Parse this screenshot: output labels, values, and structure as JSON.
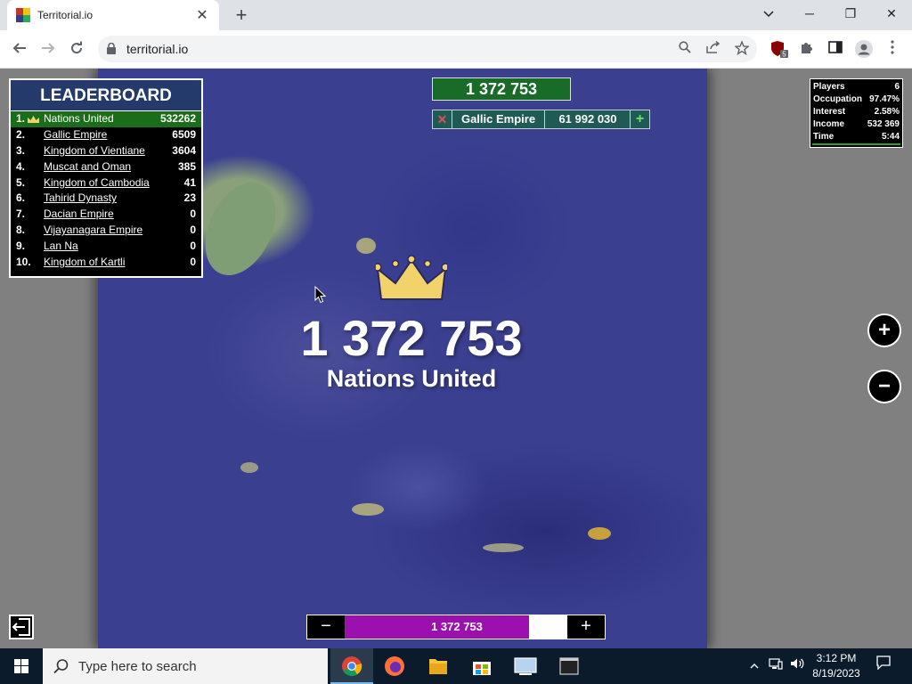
{
  "browser": {
    "tab_title": "Territorial.io",
    "tab_close": "✕",
    "new_tab": "+",
    "url": "territorial.io",
    "extension_badge": "5",
    "window_controls": {
      "minimize": "─",
      "maximize": "❐",
      "close": "✕"
    }
  },
  "leaderboard": {
    "title": "LEADERBOARD",
    "rows": [
      {
        "rank": "1.",
        "name": "Nations United",
        "score": "532262"
      },
      {
        "rank": "2.",
        "name": "Gallic Empire",
        "score": "6509"
      },
      {
        "rank": "3.",
        "name": "Kingdom of Vientiane",
        "score": "3604"
      },
      {
        "rank": "4.",
        "name": "Muscat and Oman",
        "score": "385"
      },
      {
        "rank": "5.",
        "name": "Kingdom of Cambodia",
        "score": "41"
      },
      {
        "rank": "6.",
        "name": "Tahirid Dynasty",
        "score": "23"
      },
      {
        "rank": "7.",
        "name": "Dacian Empire",
        "score": "0"
      },
      {
        "rank": "8.",
        "name": "Vijayanagara Empire",
        "score": "0"
      },
      {
        "rank": "9.",
        "name": "Lan Na",
        "score": "0"
      },
      {
        "rank": "10.",
        "name": "Kingdom of Kartli",
        "score": "0"
      }
    ]
  },
  "top_score": "1 372 753",
  "attack": {
    "close": "✕",
    "target": "Gallic Empire",
    "value": "61 992 030",
    "add": "+"
  },
  "stats": {
    "rows": [
      {
        "label": "Players",
        "value": "6"
      },
      {
        "label": "Occupation",
        "value": "97.47%"
      },
      {
        "label": "Interest",
        "value": "2.58%"
      },
      {
        "label": "Income",
        "value": "532 369"
      },
      {
        "label": "Time",
        "value": "5:44"
      }
    ]
  },
  "center": {
    "score": "1 372 753",
    "name": "Nations United"
  },
  "zoom": {
    "in": "+",
    "out": "−"
  },
  "bottom_bar": {
    "minus": "−",
    "value": "1 372 753",
    "plus": "+",
    "fill_fraction": 0.82
  },
  "taskbar": {
    "search_placeholder": "Type here to search",
    "time": "3:12 PM",
    "date": "8/19/2023"
  },
  "colors": {
    "leader_green": "#1a6e1a",
    "attack_teal": "#1f5a55",
    "bar_purple": "#9d10b0",
    "map_blue": "#3b3f90"
  }
}
